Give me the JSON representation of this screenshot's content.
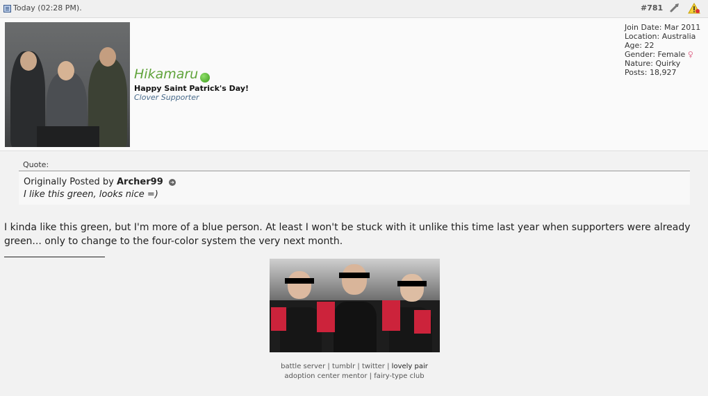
{
  "post": {
    "date": "Today (02:28 PM).",
    "number": "#781"
  },
  "user": {
    "name": "Hikamaru",
    "title": "Happy Saint Patrick's Day!",
    "rank": "Clover Supporter",
    "info": {
      "join_date": "Join Date: Mar 2011",
      "location": "Location: Australia",
      "age": "Age: 22",
      "gender": "Gender: Female",
      "nature": "Nature: Quirky",
      "posts": "Posts: 18,927"
    }
  },
  "quote": {
    "label": "Quote:",
    "posted_by_prefix": "Originally Posted by",
    "author": "Archer99",
    "text": "I like this green, looks nice =)"
  },
  "message": {
    "text": "I kinda like this green, but I'm more of a blue person. At least I won't be stuck with it unlike this time last year when supporters were already green... only to change to the four-color system the very next month."
  },
  "signature": {
    "links_row1": [
      "battle server",
      "tumblr",
      "twitter",
      "lovely pair"
    ],
    "links_row2": [
      "adoption center mentor",
      "fairy-type club"
    ],
    "separator": "|"
  },
  "colors": {
    "username": "#5fa33a",
    "online": "#3d9a1e",
    "rank": "#4a6c8c"
  }
}
